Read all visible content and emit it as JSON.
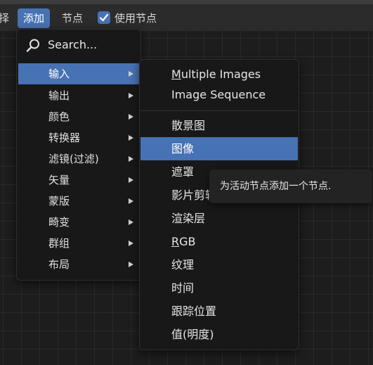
{
  "header": {
    "truncated_item": "择",
    "add_menu": "添加",
    "node_menu": "节点",
    "use_nodes_label": "使用节点",
    "use_nodes_checked": true
  },
  "add_menu": {
    "search_label": "Search...",
    "items": [
      {
        "label": "输入",
        "active": true
      },
      {
        "label": "输出"
      },
      {
        "label": "颜色"
      },
      {
        "label": "转换器"
      },
      {
        "label": "滤镜(过滤)"
      },
      {
        "label": "矢量"
      },
      {
        "label": "蒙版"
      },
      {
        "label": "畸变"
      },
      {
        "label": "群组"
      },
      {
        "label": "布局"
      }
    ]
  },
  "input_submenu": {
    "items": [
      {
        "label": "Multiple Images",
        "underline": "M"
      },
      {
        "label": "Image Sequence",
        "underline": ""
      },
      {
        "label": "散景图"
      },
      {
        "label": "图像",
        "active": true
      },
      {
        "label": "遮罩"
      },
      {
        "label": "影片剪辑"
      },
      {
        "label": "渲染层"
      },
      {
        "label": "RGB",
        "underline": "R"
      },
      {
        "label": "纹理"
      },
      {
        "label": "时间"
      },
      {
        "label": "跟踪位置"
      },
      {
        "label": "值(明度)"
      }
    ]
  },
  "tooltip": {
    "text": "为活动节点添加一个节点."
  },
  "colors": {
    "accent": "#4772b3",
    "menu_bg": "#181818",
    "header_bg": "#2b2b2b"
  }
}
